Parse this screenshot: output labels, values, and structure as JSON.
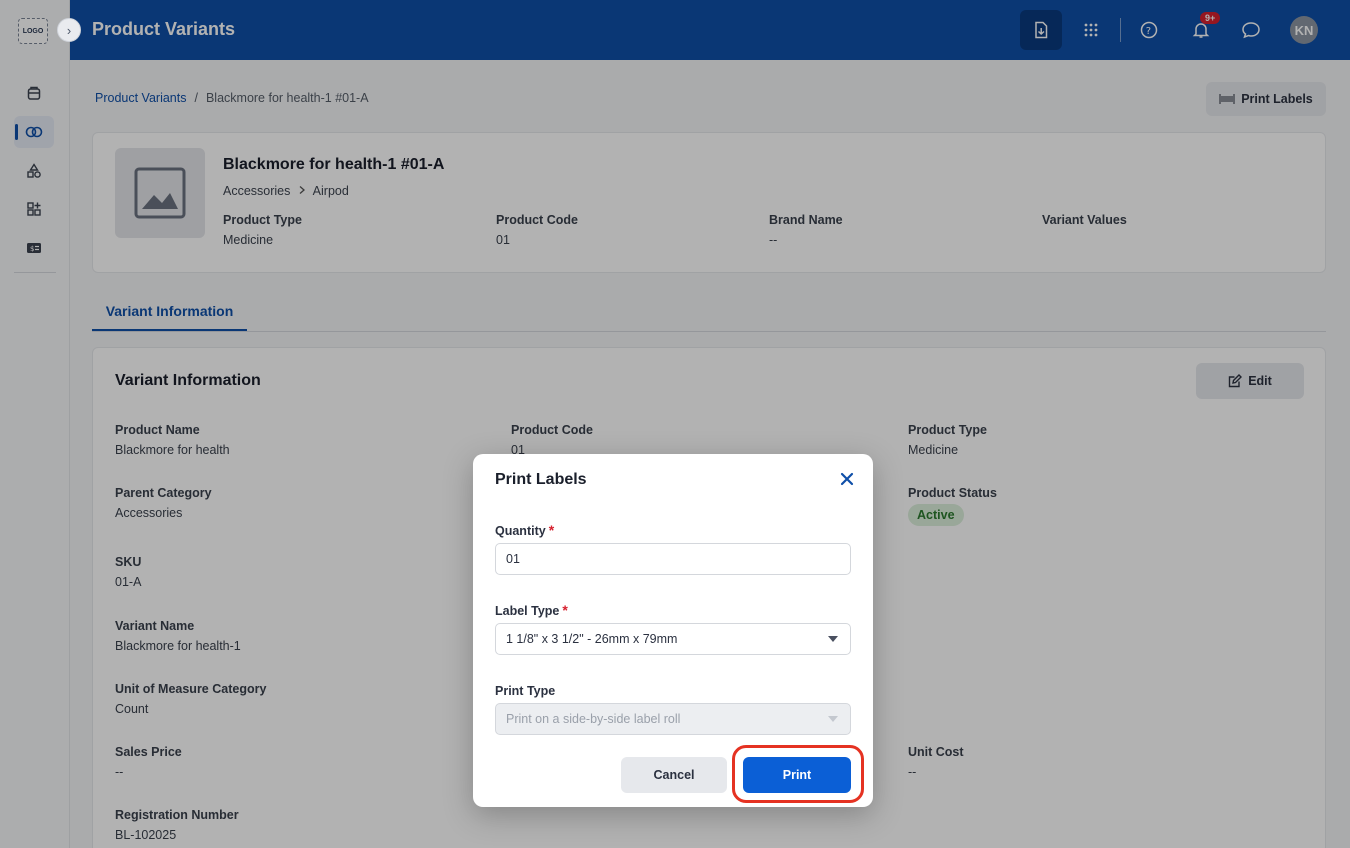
{
  "app": {
    "logo_text": "LOGO",
    "header_title": "Product Variants",
    "notification_badge": "9+",
    "avatar_initials": "KN"
  },
  "sidebar": {
    "items": [
      {
        "icon": "box-icon"
      },
      {
        "icon": "variants-icon",
        "active": true
      },
      {
        "icon": "shapes-icon"
      },
      {
        "icon": "apps-add-icon"
      },
      {
        "icon": "price-tag-icon"
      }
    ]
  },
  "breadcrumb": {
    "root": "Product Variants",
    "separator": "/",
    "current": "Blackmore for health-1 #01-A"
  },
  "actions": {
    "print_labels": "Print Labels"
  },
  "product": {
    "title": "Blackmore for health-1 #01-A",
    "category": "Accessories",
    "subcategory": "Airpod",
    "meta": [
      {
        "label": "Product Type",
        "value": "Medicine"
      },
      {
        "label": "Product Code",
        "value": "01"
      },
      {
        "label": "Brand Name",
        "value": "--"
      },
      {
        "label": "Variant Values",
        "value": ""
      }
    ]
  },
  "tabs": {
    "active": "Variant Information"
  },
  "variant_info": {
    "title": "Variant Information",
    "edit_label": "Edit",
    "fields": {
      "product_name": {
        "label": "Product Name",
        "value": "Blackmore for health"
      },
      "product_code": {
        "label": "Product Code",
        "value": "01"
      },
      "product_type": {
        "label": "Product Type",
        "value": "Medicine"
      },
      "parent_category": {
        "label": "Parent Category",
        "value": "Accessories"
      },
      "product_status": {
        "label": "Product Status",
        "value": "Active"
      },
      "sku": {
        "label": "SKU",
        "value": "01-A"
      },
      "variant_name": {
        "label": "Variant Name",
        "value": "Blackmore for health-1"
      },
      "uom_category": {
        "label": "Unit of Measure Category",
        "value": "Count"
      },
      "sales_price": {
        "label": "Sales Price",
        "value": "--"
      },
      "unit_cost": {
        "label": "Unit Cost",
        "value": "--"
      },
      "registration_number": {
        "label": "Registration Number",
        "value": "BL-102025"
      }
    }
  },
  "dialog": {
    "title": "Print Labels",
    "quantity_label": "Quantity",
    "quantity_value": "01",
    "label_type_label": "Label Type",
    "label_type_value": "1 1/8\" x 3 1/2\" - 26mm x 79mm",
    "print_type_label": "Print Type",
    "print_type_value": "Print on a side-by-side label roll",
    "required_mark": "*",
    "cancel_label": "Cancel",
    "print_label": "Print"
  },
  "colors": {
    "primary": "#0f4fa8",
    "button_blue": "#0b5fd6",
    "highlight_red": "#e53222",
    "status_green": "#2b7a2f"
  }
}
